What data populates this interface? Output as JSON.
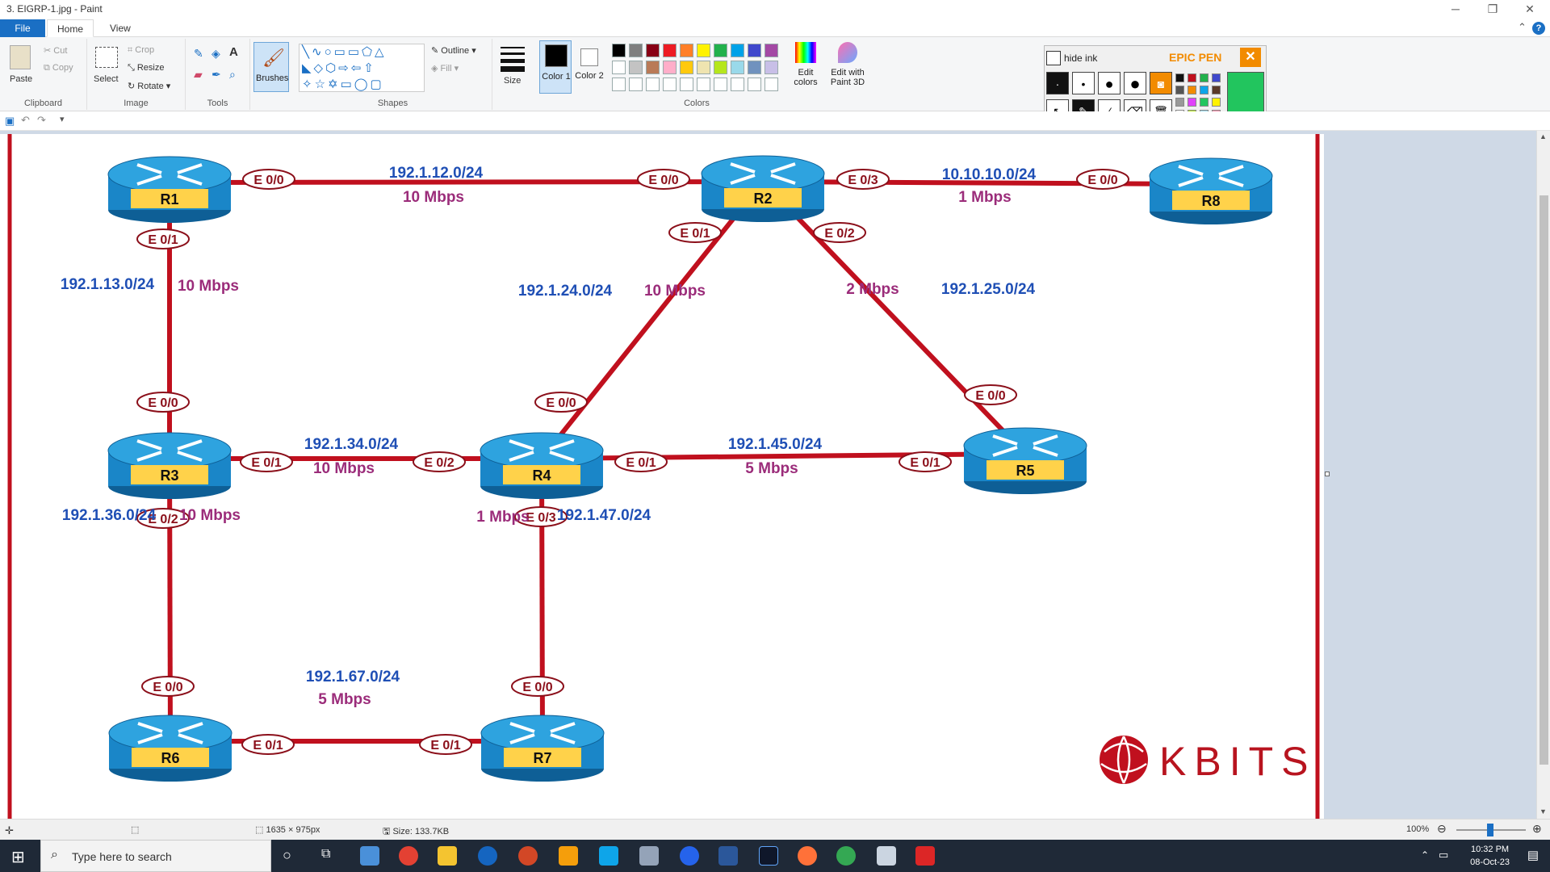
{
  "window": {
    "title": "3. EIGRP-1.jpg - Paint",
    "minimize": "─",
    "maximize": "❐",
    "close": "✕"
  },
  "menu": {
    "file": "File",
    "home": "Home",
    "view": "View",
    "collapse": "⌃",
    "help": "?"
  },
  "ribbon": {
    "clipboard": {
      "paste": "Paste",
      "cut": "Cut",
      "copy": "Copy",
      "label": "Clipboard"
    },
    "image": {
      "select": "Select",
      "crop": "Crop",
      "resize": "Resize",
      "rotate": "Rotate",
      "label": "Image"
    },
    "tools": {
      "label": "Tools",
      "text_tool": "A"
    },
    "brushes": "Brushes",
    "shapes": {
      "outline": "Outline",
      "fill": "Fill",
      "label": "Shapes"
    },
    "size": "Size",
    "color1": "Color 1",
    "color2": "Color 2",
    "colors_label": "Colors",
    "edit_colors": "Edit colors",
    "paint3d": "Edit with Paint 3D",
    "palette_row1": [
      "#000000",
      "#7f7f7f",
      "#880015",
      "#ed1c24",
      "#ff7f27",
      "#fff200",
      "#22b14c",
      "#00a2e8",
      "#3f48cc",
      "#a349a4"
    ],
    "palette_row2": [
      "#ffffff",
      "#c3c3c3",
      "#b97a57",
      "#ffaec9",
      "#ffc90e",
      "#efe4b0",
      "#b5e61d",
      "#99d9ea",
      "#7092be",
      "#c8bfe7"
    ]
  },
  "epic_pen": {
    "hide_ink": "hide ink",
    "title": "EPIC PEN",
    "close": "✕",
    "active_color": "#22c55e"
  },
  "diagram": {
    "routers": {
      "r1": "R1",
      "r2": "R2",
      "r3": "R3",
      "r4": "R4",
      "r5": "R5",
      "r6": "R6",
      "r7": "R7",
      "r8": "R8"
    },
    "links": {
      "r1_r2": {
        "subnet": "192.1.12.0/24",
        "bw": "10 Mbps",
        "if_a": "E 0/0",
        "if_b": "E 0/0"
      },
      "r2_r8": {
        "subnet": "10.10.10.0/24",
        "bw": "1 Mbps",
        "if_a": "E 0/3",
        "if_b": "E 0/0"
      },
      "r1_r3": {
        "subnet": "192.1.13.0/24",
        "bw": "10 Mbps",
        "if_a": "E 0/1",
        "if_b": "E 0/0"
      },
      "r2_r4": {
        "subnet": "192.1.24.0/24",
        "bw": "10 Mbps",
        "if_a": "E 0/1",
        "if_b": "E 0/0"
      },
      "r2_r5": {
        "subnet": "192.1.25.0/24",
        "bw": "2 Mbps",
        "if_a": "E 0/2",
        "if_b": "E 0/0"
      },
      "r3_r4": {
        "subnet": "192.1.34.0/24",
        "bw": "10 Mbps",
        "if_a": "E 0/1",
        "if_b": "E 0/2"
      },
      "r4_r5": {
        "subnet": "192.1.45.0/24",
        "bw": "5 Mbps",
        "if_a": "E 0/1",
        "if_b": "E 0/1"
      },
      "r3_r6": {
        "subnet": "192.1.36.0/24",
        "bw": "10 Mbps",
        "if_a": "E 0/2",
        "if_b": "E 0/0"
      },
      "r4_r7": {
        "subnet": "192.1.47.0/24",
        "bw": "1 Mbps",
        "if_a": "E 0/3",
        "if_b": "E 0/0"
      },
      "r6_r7": {
        "subnet": "192.1.67.0/24",
        "bw": "5 Mbps",
        "if_a": "E 0/1",
        "if_b": "E 0/1"
      }
    },
    "logo": "KBITS",
    "colors": {
      "link": "#c0101e",
      "subnet": "#1f4fb5",
      "bandwidth": "#9b2c7a",
      "router": "#1a86c8",
      "router_label_bg": "#ffd24a",
      "iface_text": "#8b0f1a"
    }
  },
  "status": {
    "dimensions": "1635 × 975px",
    "size": "Size: 133.7KB",
    "zoom": "100%"
  },
  "taskbar": {
    "search_placeholder": "Type here to search",
    "time": "10:32 PM",
    "date": "08-Oct-23"
  }
}
